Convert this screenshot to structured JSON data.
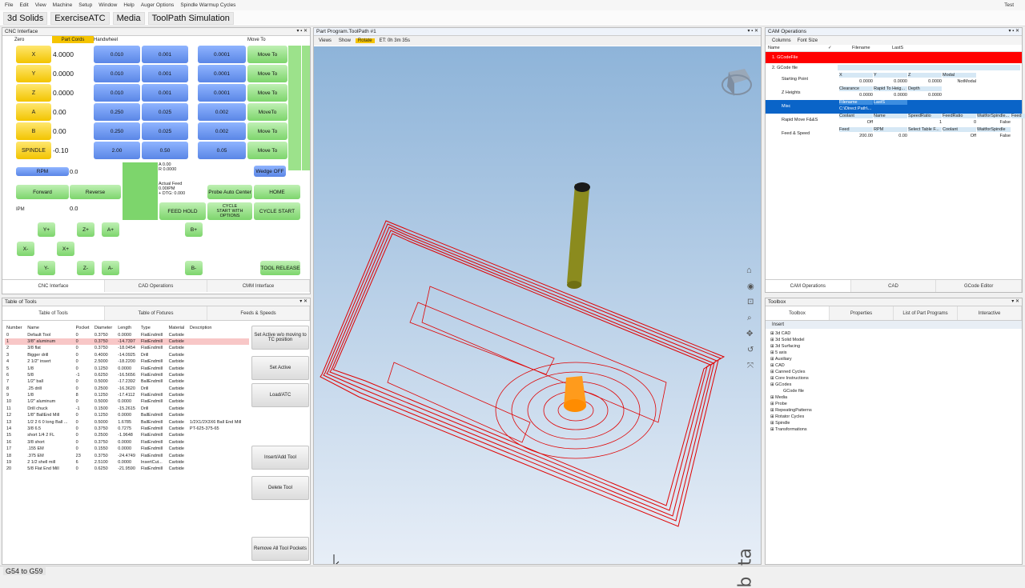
{
  "menu": [
    "File",
    "Edit",
    "View",
    "Machine",
    "Setup",
    "Window",
    "Help",
    "Auger Options",
    "Spindle Warmup Cycles"
  ],
  "menu_right": "Test",
  "toolbar": [
    "3d Solids",
    "ExerciseATC",
    "Media",
    "ToolPath Simulation"
  ],
  "cnc": {
    "title": "CNC Interface",
    "zero": "Zero",
    "part_cords": "Part Cords",
    "handwheel": "Handwheel",
    "move_to": "Move To",
    "axes": [
      {
        "label": "X",
        "value": "4.0000",
        "h": [
          "0.010",
          "0.001",
          "0.0001"
        ],
        "move": "Move To"
      },
      {
        "label": "Y",
        "value": "0.0000",
        "h": [
          "0.010",
          "0.001",
          "0.0001"
        ],
        "move": "Move To"
      },
      {
        "label": "Z",
        "value": "0.0000",
        "h": [
          "0.010",
          "0.001",
          "0.0001"
        ],
        "move": "Move To"
      },
      {
        "label": "A",
        "value": "0.00",
        "h": [
          "0.250",
          "0.025",
          "0.002"
        ],
        "move": "MoveTo"
      },
      {
        "label": "B",
        "value": "0.00",
        "h": [
          "0.250",
          "0.025",
          "0.002"
        ],
        "move": "Move To"
      },
      {
        "label": "SPINDLE",
        "value": "-0.10",
        "h": [
          "2.00",
          "0.50",
          "0.05"
        ],
        "move": "Move To"
      }
    ],
    "rpm": "RPM",
    "rpm_val": "0.0",
    "ab_status": "A 0.00\nR 0.0000",
    "actual_feed": "Actual Feed\n0.00IPM\n+ DTG: 0.000",
    "wedge": "Wedge OFF",
    "forward": "Forward",
    "reverse": "Reverse",
    "probe": "Probe Auto Center",
    "home": "HOME",
    "ipm": "IPM",
    "ipm_val": "0.0",
    "feed_hold": "FEED HOLD",
    "cycle_opts": "CYCLE\nSTART WITH\nOPTIONS",
    "cycle_start": "CYCLE START",
    "jog": {
      "yp": "Y+",
      "zp": "Z+",
      "ap": "A+",
      "bp": "B+",
      "xm": "X-",
      "xp": "X+",
      "ym": "Y-",
      "zm": "Z-",
      "am": "A-",
      "bm": "B-"
    },
    "tool_release": "TOOL RELEASE",
    "tabs": [
      "CNC Interface",
      "CAD Operations",
      "CMM Interface"
    ]
  },
  "tools": {
    "title": "Table of Tools",
    "tabs": [
      "Table of Tools",
      "Table of Fixtures",
      "Feeds & Speeds"
    ],
    "cols": [
      "Number",
      "Name",
      "Pocket",
      "Diameter",
      "Length",
      "Type",
      "Material",
      "Description"
    ],
    "rows": [
      [
        "0",
        "Default Tool",
        "0",
        "0.3750",
        "0.0000",
        "FlatEndmill",
        "Carbide",
        ""
      ],
      [
        "1",
        "3/8\" aluminum",
        "0",
        "0.3750",
        "-14.7397",
        "FlatEndmill",
        "Carbide",
        ""
      ],
      [
        "2",
        "3/8 flat",
        "0",
        "0.3750",
        "-18.0454",
        "FlatEndmill",
        "Carbide",
        ""
      ],
      [
        "3",
        "Bigger drill",
        "0",
        "0.4000",
        "-14.0925",
        "Drill",
        "Carbide",
        ""
      ],
      [
        "4",
        "2 1/2\" insert",
        "0",
        "2.5000",
        "-18.2200",
        "FlatEndmill",
        "Carbide",
        ""
      ],
      [
        "5",
        "1/8",
        "0",
        "0.1250",
        "0.0000",
        "FlatEndmill",
        "Carbide",
        ""
      ],
      [
        "6",
        "5/8",
        "-1",
        "0.6250",
        "-16.5656",
        "FlatEndmill",
        "Carbide",
        ""
      ],
      [
        "7",
        "1/2\" ball",
        "0",
        "0.5000",
        "-17.2392",
        "BallEndmill",
        "Carbide",
        ""
      ],
      [
        "8",
        ".25 drill",
        "0",
        "0.2500",
        "-16.3620",
        "Drill",
        "Carbide",
        ""
      ],
      [
        "9",
        "1/8",
        "8",
        "0.1250",
        "-17.4112",
        "FlatEndmill",
        "Carbide",
        ""
      ],
      [
        "10",
        "1/2\" aluminum",
        "0",
        "0.5000",
        "0.0000",
        "FlatEndmill",
        "Carbide",
        ""
      ],
      [
        "11",
        "Drill chuck",
        "-1",
        "0.1500",
        "-15.2615",
        "Drill",
        "Carbide",
        ""
      ],
      [
        "12",
        "1/8\" BallEnd Mill",
        "0",
        "0.1250",
        "0.0000",
        "BallEndmill",
        "Carbide",
        ""
      ],
      [
        "13",
        "1/2 2 6 0 long Ball ...",
        "0",
        "0.5000",
        "1.6785",
        "BallEndmill",
        "Carbide",
        "1/2X1/2X3X6 Ball End Mill"
      ],
      [
        "14",
        "3/8 6.5",
        "0",
        "0.3750",
        "0.7275",
        "FlatEndmill",
        "Carbide",
        "PT-625-375-65"
      ],
      [
        "15",
        "short 1/4 2 FL",
        "0",
        "0.2500",
        "-1.9648",
        "FlatEndmill",
        "Carbide",
        ""
      ],
      [
        "16",
        "3/8 short",
        "0",
        "0.3750",
        "0.0000",
        "FlatEndmill",
        "Carbide",
        ""
      ],
      [
        "17",
        ".155 EM",
        "0",
        "0.1550",
        "0.0000",
        "FlatEndmill",
        "Carbide",
        ""
      ],
      [
        "18",
        ".375 EM",
        "23",
        "0.3750",
        "-24.4749",
        "FlatEndmill",
        "Carbide",
        ""
      ],
      [
        "19",
        "2 1/2 shell mill",
        "6",
        "2.5100",
        "0.0000",
        "InsertCut...",
        "Carbide",
        ""
      ],
      [
        "20",
        "5/8 Flat End Mill",
        "0",
        "0.6250",
        "-21.9590",
        "FlatEndmill",
        "Carbide",
        ""
      ]
    ],
    "btns": [
      "Set Active w/o moving to TC position",
      "Set Active",
      "Load/ATC",
      "Insert/Add Tool",
      "Delete Tool",
      "Remove All Tool Pockets"
    ]
  },
  "view": {
    "title": "Part Program.ToolPath #1",
    "bar": [
      "Views",
      "Show",
      "Rotate"
    ],
    "et": "ET: 0h 3m 35s",
    "beta": "beta"
  },
  "cam": {
    "title": "CAM Operations",
    "bar": [
      "Columns",
      "Font Size"
    ],
    "cols": [
      "Name",
      "✓",
      "Filename",
      "LastS"
    ],
    "item1": "1. GCodeFile",
    "item2": "2. GCode file",
    "rows": [
      {
        "name": "Starting Point",
        "h": [
          "X",
          "Y",
          "Z",
          "Modal"
        ],
        "v": [
          "0.0000",
          "0.0000",
          "0.0000",
          "NotModal"
        ]
      },
      {
        "name": "Z Heights",
        "h": [
          "Clearance",
          "Rapid To Heig...",
          "Depth"
        ],
        "v": [
          "0.0000",
          "0.0000",
          "0.0000"
        ]
      },
      {
        "name": "Misc",
        "h": [
          "Filename",
          "LastS"
        ],
        "v": [
          "C:\\Direct Path\\..."
        ]
      },
      {
        "name": "Rapid Move F&&S",
        "h": [
          "Coolant",
          "Name",
          "SpeedRatio",
          "FeedRatio",
          "WaitforSpindle...",
          "Feed"
        ],
        "v": [
          "Off",
          "",
          "1",
          "0",
          "False"
        ]
      },
      {
        "name": "Feed & Speed",
        "h": [
          "Feed",
          "RPM",
          "Select Table F...",
          "Coolant",
          "WaitforSpindle"
        ],
        "v": [
          "200.00",
          "0.00",
          "",
          "Off",
          "False"
        ]
      }
    ],
    "tabs": [
      "CAM Operations",
      "CAD",
      "GCode Editor"
    ]
  },
  "toolbox": {
    "title": "Toolbox",
    "tabs": [
      "Toolbox",
      "Properties",
      "List of Part Programs",
      "Interactive"
    ],
    "insert": "Insert",
    "items": [
      "3d CAD",
      "3d Solid Model",
      "3d Surfacing",
      "5 axis",
      "Auxiliary",
      "CAD",
      "Canned Cycles",
      "Core Instructions",
      "GCodes",
      "GCode file",
      "Media",
      "Probe",
      "RepeatingPatterns",
      "Rotator Cycles",
      "Spindle",
      "Transformations"
    ]
  },
  "status": "G54 to G59"
}
